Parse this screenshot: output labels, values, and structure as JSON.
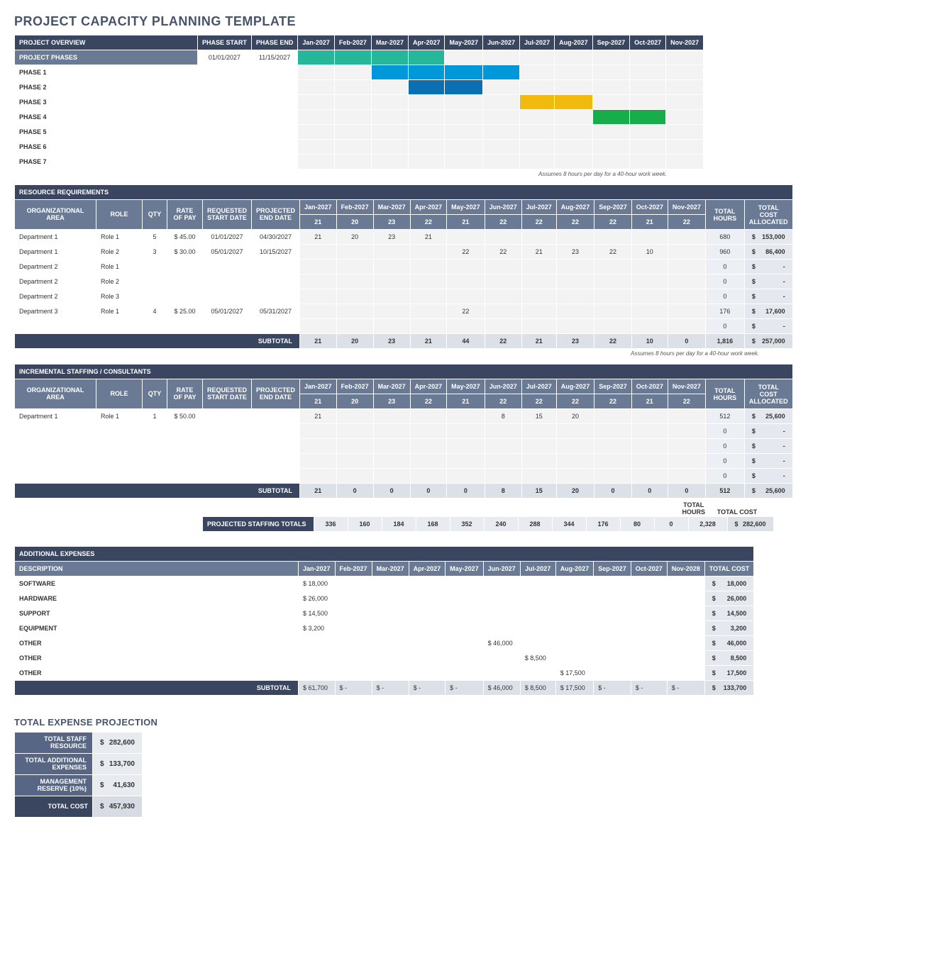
{
  "title": "PROJECT CAPACITY PLANNING TEMPLATE",
  "note": "Assumes 8 hours per day for a 40-hour work week.",
  "months": [
    "Jan-2027",
    "Feb-2027",
    "Mar-2027",
    "Apr-2027",
    "May-2027",
    "Jun-2027",
    "Jul-2027",
    "Aug-2027",
    "Sep-2027",
    "Oct-2027",
    "Nov-2027"
  ],
  "overview": {
    "header_overview": "PROJECT OVERVIEW",
    "header_start": "PHASE START",
    "header_end": "PHASE END",
    "phases_header": "PROJECT PHASES",
    "start": "01/01/2027",
    "end": "11/15/2027",
    "phase_labels": [
      "PHASE 1",
      "PHASE 2",
      "PHASE 3",
      "PHASE 4",
      "PHASE 5",
      "PHASE 6",
      "PHASE 7"
    ],
    "gantt": [
      [
        "teal",
        "teal",
        "teal",
        "teal",
        "",
        "",
        "",
        "",
        "",
        "",
        ""
      ],
      [
        "",
        "",
        "blue",
        "blue",
        "blue",
        "blue",
        "",
        "",
        "",
        "",
        ""
      ],
      [
        "",
        "",
        "",
        "dblue",
        "dblue",
        "",
        "",
        "",
        "",
        "",
        ""
      ],
      [
        "",
        "",
        "",
        "",
        "",
        "",
        "yellow",
        "yellow",
        "",
        "",
        ""
      ],
      [
        "",
        "",
        "",
        "",
        "",
        "",
        "",
        "",
        "green",
        "green",
        ""
      ],
      [
        "",
        "",
        "",
        "",
        "",
        "",
        "",
        "",
        "",
        "",
        ""
      ],
      [
        "",
        "",
        "",
        "",
        "",
        "",
        "",
        "",
        "",
        "",
        ""
      ],
      [
        "",
        "",
        "",
        "",
        "",
        "",
        "",
        "",
        "",
        "",
        ""
      ]
    ]
  },
  "resource": {
    "title": "RESOURCE REQUIREMENTS",
    "cols": [
      "ORGANIZATIONAL AREA",
      "ROLE",
      "QTY",
      "RATE OF PAY",
      "REQUESTED START DATE",
      "PROJECTED END DATE"
    ],
    "month_days": [
      "21",
      "20",
      "23",
      "22",
      "21",
      "22",
      "22",
      "22",
      "22",
      "21",
      "22"
    ],
    "total_hours": "TOTAL HOURS",
    "total_cost": "TOTAL COST ALLOCATED",
    "rows": [
      {
        "area": "Department 1",
        "role": "Role 1",
        "qty": "5",
        "rate": "$ 45.00",
        "start": "01/01/2027",
        "end": "04/30/2027",
        "m": [
          "21",
          "20",
          "23",
          "21",
          "",
          "",
          "",
          "",
          "",
          "",
          ""
        ],
        "hours": "680",
        "cost": "153,000"
      },
      {
        "area": "Department 1",
        "role": "Role 2",
        "qty": "3",
        "rate": "$ 30.00",
        "start": "05/01/2027",
        "end": "10/15/2027",
        "m": [
          "",
          "",
          "",
          "",
          "22",
          "22",
          "21",
          "23",
          "22",
          "10",
          ""
        ],
        "hours": "960",
        "cost": "86,400"
      },
      {
        "area": "Department 2",
        "role": "Role 1",
        "qty": "",
        "rate": "",
        "start": "",
        "end": "",
        "m": [
          "",
          "",
          "",
          "",
          "",
          "",
          "",
          "",
          "",
          "",
          ""
        ],
        "hours": "0",
        "cost": "-"
      },
      {
        "area": "Department 2",
        "role": "Role 2",
        "qty": "",
        "rate": "",
        "start": "",
        "end": "",
        "m": [
          "",
          "",
          "",
          "",
          "",
          "",
          "",
          "",
          "",
          "",
          ""
        ],
        "hours": "0",
        "cost": "-"
      },
      {
        "area": "Department 2",
        "role": "Role 3",
        "qty": "",
        "rate": "",
        "start": "",
        "end": "",
        "m": [
          "",
          "",
          "",
          "",
          "",
          "",
          "",
          "",
          "",
          "",
          ""
        ],
        "hours": "0",
        "cost": "-"
      },
      {
        "area": "Department 3",
        "role": "Role 1",
        "qty": "4",
        "rate": "$ 25.00",
        "start": "05/01/2027",
        "end": "05/31/2027",
        "m": [
          "",
          "",
          "",
          "",
          "22",
          "",
          "",
          "",
          "",
          "",
          ""
        ],
        "hours": "176",
        "cost": "17,600"
      },
      {
        "area": "",
        "role": "",
        "qty": "",
        "rate": "",
        "start": "",
        "end": "",
        "m": [
          "",
          "",
          "",
          "",
          "",
          "",
          "",
          "",
          "",
          "",
          ""
        ],
        "hours": "0",
        "cost": "-"
      }
    ],
    "subtotal_label": "SUBTOTAL",
    "subtotal_m": [
      "21",
      "20",
      "23",
      "21",
      "44",
      "22",
      "21",
      "23",
      "22",
      "10",
      "0"
    ],
    "subtotal_hours": "1,816",
    "subtotal_cost": "257,000"
  },
  "staffing": {
    "title": "INCREMENTAL STAFFING / CONSULTANTS",
    "month_days": [
      "21",
      "20",
      "23",
      "22",
      "21",
      "22",
      "22",
      "22",
      "22",
      "21",
      "22"
    ],
    "rows": [
      {
        "area": "Department 1",
        "role": "Role 1",
        "qty": "1",
        "rate": "$ 50.00",
        "start": "",
        "end": "",
        "m": [
          "21",
          "",
          "",
          "",
          "",
          "8",
          "15",
          "20",
          "",
          "",
          ""
        ],
        "hours": "512",
        "cost": "25,600"
      },
      {
        "area": "",
        "role": "",
        "qty": "",
        "rate": "",
        "start": "",
        "end": "",
        "m": [
          "",
          "",
          "",
          "",
          "",
          "",
          "",
          "",
          "",
          "",
          ""
        ],
        "hours": "0",
        "cost": "-"
      },
      {
        "area": "",
        "role": "",
        "qty": "",
        "rate": "",
        "start": "",
        "end": "",
        "m": [
          "",
          "",
          "",
          "",
          "",
          "",
          "",
          "",
          "",
          "",
          ""
        ],
        "hours": "0",
        "cost": "-"
      },
      {
        "area": "",
        "role": "",
        "qty": "",
        "rate": "",
        "start": "",
        "end": "",
        "m": [
          "",
          "",
          "",
          "",
          "",
          "",
          "",
          "",
          "",
          "",
          ""
        ],
        "hours": "0",
        "cost": "-"
      },
      {
        "area": "",
        "role": "",
        "qty": "",
        "rate": "",
        "start": "",
        "end": "",
        "m": [
          "",
          "",
          "",
          "",
          "",
          "",
          "",
          "",
          "",
          "",
          ""
        ],
        "hours": "0",
        "cost": "-"
      }
    ],
    "subtotal_label": "SUBTOTAL",
    "subtotal_m": [
      "21",
      "0",
      "0",
      "0",
      "0",
      "8",
      "15",
      "20",
      "0",
      "0",
      "0"
    ],
    "subtotal_hours": "512",
    "subtotal_cost": "25,600"
  },
  "projected": {
    "label": "PROJECTED STAFFING TOTALS",
    "top_hours": "TOTAL HOURS",
    "top_cost": "TOTAL COST",
    "m": [
      "336",
      "160",
      "184",
      "168",
      "352",
      "240",
      "288",
      "344",
      "176",
      "80",
      "0"
    ],
    "hours": "2,328",
    "cost": "282,600"
  },
  "expenses": {
    "title": "ADDITIONAL EXPENSES",
    "desc": "DESCRIPTION",
    "total": "TOTAL COST",
    "months_ex": [
      "Jan-2027",
      "Feb-2027",
      "Mar-2027",
      "Apr-2027",
      "May-2027",
      "Jun-2027",
      "Jul-2027",
      "Aug-2027",
      "Sep-2027",
      "Oct-2027",
      "Nov-2028"
    ],
    "rows": [
      {
        "d": "SOFTWARE",
        "m": [
          "$ 18,000",
          "",
          "",
          "",
          "",
          "",
          "",
          "",
          "",
          "",
          ""
        ],
        "t": "18,000"
      },
      {
        "d": "HARDWARE",
        "m": [
          "$ 26,000",
          "",
          "",
          "",
          "",
          "",
          "",
          "",
          "",
          "",
          ""
        ],
        "t": "26,000"
      },
      {
        "d": "SUPPORT",
        "m": [
          "$ 14,500",
          "",
          "",
          "",
          "",
          "",
          "",
          "",
          "",
          "",
          ""
        ],
        "t": "14,500"
      },
      {
        "d": "EQUIPMENT",
        "m": [
          "$   3,200",
          "",
          "",
          "",
          "",
          "",
          "",
          "",
          "",
          "",
          ""
        ],
        "t": "3,200"
      },
      {
        "d": "OTHER",
        "m": [
          "",
          "",
          "",
          "",
          "",
          "$ 46,000",
          "",
          "",
          "",
          "",
          ""
        ],
        "t": "46,000"
      },
      {
        "d": "OTHER",
        "m": [
          "",
          "",
          "",
          "",
          "",
          "",
          "$  8,500",
          "",
          "",
          "",
          ""
        ],
        "t": "8,500"
      },
      {
        "d": "OTHER",
        "m": [
          "",
          "",
          "",
          "",
          "",
          "",
          "",
          "$ 17,500",
          "",
          "",
          ""
        ],
        "t": "17,500"
      }
    ],
    "subtotal_label": "SUBTOTAL",
    "subtotal_m": [
      "$ 61,700",
      "$      -",
      "$      -",
      "$      -",
      "$      -",
      "$ 46,000",
      "$  8,500",
      "$ 17,500",
      "$      -",
      "$      -",
      "$      -"
    ],
    "subtotal_t": "133,700"
  },
  "projection": {
    "title": "TOTAL EXPENSE PROJECTION",
    "rows": [
      {
        "l": "TOTAL STAFF RESOURCE",
        "v": "282,600"
      },
      {
        "l": "TOTAL ADDITIONAL EXPENSES",
        "v": "133,700"
      },
      {
        "l": "MANAGEMENT RESERVE (10%)",
        "v": "41,630"
      },
      {
        "l": "TOTAL COST",
        "v": "457,930"
      }
    ]
  }
}
